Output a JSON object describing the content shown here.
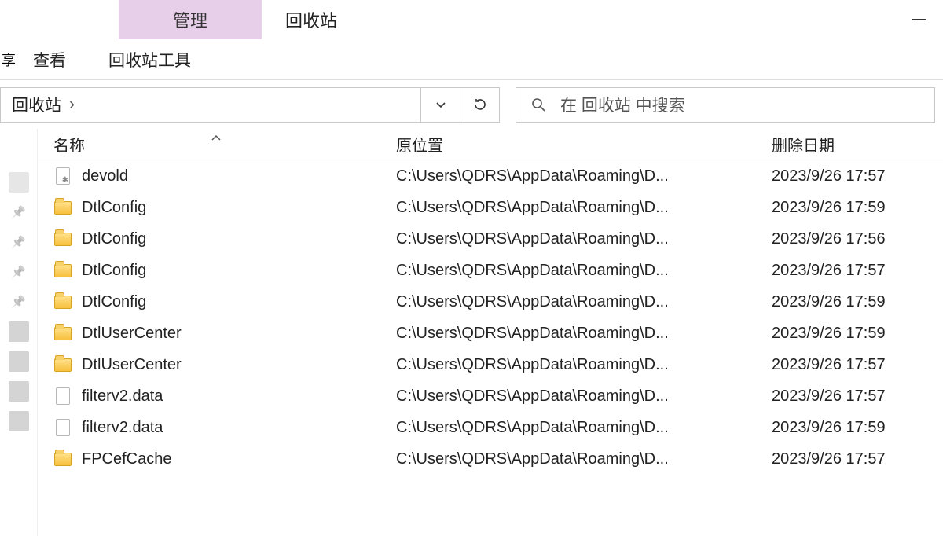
{
  "title": {
    "context_tab": "管理",
    "window_title": "回收站"
  },
  "ribbon": {
    "partial_tab": "享",
    "tabs": [
      "查看",
      "回收站工具"
    ]
  },
  "address": {
    "segments": [
      "回收站"
    ],
    "separator": "›"
  },
  "search": {
    "placeholder": "在 回收站 中搜索"
  },
  "columns": {
    "name": "名称",
    "origin": "原位置",
    "deleted": "删除日期"
  },
  "rows": [
    {
      "icon": "gearfile",
      "name": "devold",
      "origin": "C:\\Users\\QDRS\\AppData\\Roaming\\D...",
      "deleted": "2023/9/26 17:57"
    },
    {
      "icon": "folder",
      "name": "DtlConfig",
      "origin": "C:\\Users\\QDRS\\AppData\\Roaming\\D...",
      "deleted": "2023/9/26 17:59"
    },
    {
      "icon": "folder",
      "name": "DtlConfig",
      "origin": "C:\\Users\\QDRS\\AppData\\Roaming\\D...",
      "deleted": "2023/9/26 17:56"
    },
    {
      "icon": "folder",
      "name": "DtlConfig",
      "origin": "C:\\Users\\QDRS\\AppData\\Roaming\\D...",
      "deleted": "2023/9/26 17:57"
    },
    {
      "icon": "folder",
      "name": "DtlConfig",
      "origin": "C:\\Users\\QDRS\\AppData\\Roaming\\D...",
      "deleted": "2023/9/26 17:59"
    },
    {
      "icon": "folder",
      "name": "DtlUserCenter",
      "origin": "C:\\Users\\QDRS\\AppData\\Roaming\\D...",
      "deleted": "2023/9/26 17:59"
    },
    {
      "icon": "folder",
      "name": "DtlUserCenter",
      "origin": "C:\\Users\\QDRS\\AppData\\Roaming\\D...",
      "deleted": "2023/9/26 17:57"
    },
    {
      "icon": "file",
      "name": "filterv2.data",
      "origin": "C:\\Users\\QDRS\\AppData\\Roaming\\D...",
      "deleted": "2023/9/26 17:57"
    },
    {
      "icon": "file",
      "name": "filterv2.data",
      "origin": "C:\\Users\\QDRS\\AppData\\Roaming\\D...",
      "deleted": "2023/9/26 17:59"
    },
    {
      "icon": "folder",
      "name": "FPCefCache",
      "origin": "C:\\Users\\QDRS\\AppData\\Roaming\\D...",
      "deleted": "2023/9/26 17:57"
    }
  ]
}
